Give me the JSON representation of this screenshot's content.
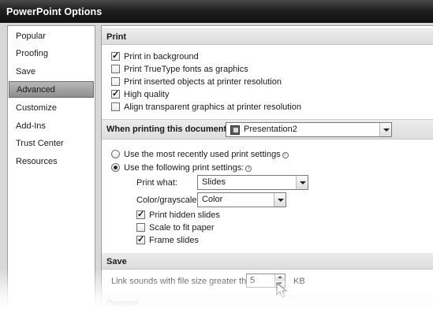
{
  "window": {
    "title": "PowerPoint Options"
  },
  "sidebar": {
    "items": [
      {
        "label": "Popular"
      },
      {
        "label": "Proofing"
      },
      {
        "label": "Save"
      },
      {
        "label": "Advanced",
        "active": true
      },
      {
        "label": "Customize"
      },
      {
        "label": "Add-Ins"
      },
      {
        "label": "Trust Center"
      },
      {
        "label": "Resources"
      }
    ]
  },
  "print_section": {
    "title": "Print",
    "options": [
      {
        "label": "Print in background",
        "checked": true
      },
      {
        "label": "Print TrueType fonts as graphics",
        "checked": false
      },
      {
        "label": "Print inserted objects at printer resolution",
        "checked": false
      },
      {
        "label": "High quality",
        "checked": true
      },
      {
        "label": "Align transparent graphics at printer resolution",
        "checked": false
      }
    ]
  },
  "when_printing": {
    "label": "When printing this document:",
    "document": "Presentation2",
    "doc_icon": "powerpoint-document-icon"
  },
  "print_settings": {
    "recent_label": "Use the most recently used print settings",
    "following_label": "Use the following print settings:",
    "selected": "following",
    "print_what_label": "Print what:",
    "print_what_value": "Slides",
    "color_label": "Color/grayscale:",
    "color_value": "Color",
    "checks": [
      {
        "label": "Print hidden slides",
        "checked": true
      },
      {
        "label": "Scale to fit paper",
        "checked": false
      },
      {
        "label": "Frame slides",
        "checked": true
      }
    ]
  },
  "save_section": {
    "title": "Save",
    "link_label": "Link sounds with file size greater than:",
    "link_value": "5",
    "unit": "KB"
  },
  "general_section": {
    "title": "General"
  },
  "colors": {
    "active_item": "#9e9e9e",
    "section_header": "#e4e4e4",
    "frame": "#d8d8d8"
  }
}
